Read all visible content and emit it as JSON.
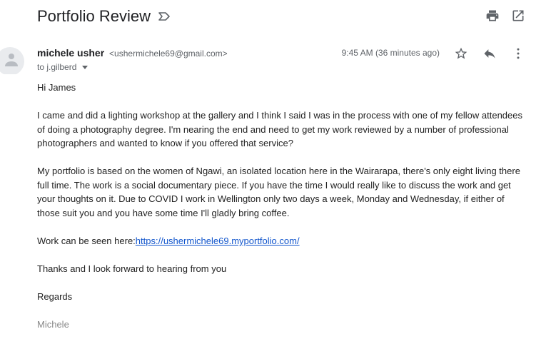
{
  "header": {
    "subject": "Portfolio Review",
    "label_icon": "label-outline-icon",
    "print_icon": "print-icon",
    "open_new_window_icon": "open-in-new-icon"
  },
  "message": {
    "sender_name": "michele usher",
    "sender_email": "<ushermichele69@gmail.com>",
    "to": "to j.gilberd",
    "timestamp": "9:45 AM (36 minutes ago)",
    "icons": {
      "avatar": "default-avatar-icon",
      "star": "star-outline-icon",
      "reply": "reply-icon",
      "more": "more-vert-icon"
    }
  },
  "body": {
    "greeting": "Hi James",
    "para1": "I came and did a lighting workshop at the gallery and I think I said I was in the process with one of my fellow attendees of doing a photography degree.  I'm nearing the end and need to get my work reviewed by a number of professional photographers and wanted to know if you offered that service?",
    "para2": "My portfolio is based on the women of Ngawi, an isolated location here in the Wairarapa, there's only eight living there full time.  The work is a social documentary piece.  If you have the time I would really like to discuss the work and get your thoughts on it.  Due to COVID I work in Wellington only two days a week, Monday and Wednesday, if either of those suit you and you have some time I'll gladly bring coffee.",
    "work_prefix": "Work can be seen here:",
    "work_link": "https://ushermichele69.myportfolio.com/",
    "thanks": "Thanks and I look forward to hearing from you",
    "regards": "Regards",
    "signature": "Michele"
  },
  "colors": {
    "link": "#1155cc",
    "icon": "#5f6368",
    "text": "#222222",
    "signature": "#888888"
  }
}
